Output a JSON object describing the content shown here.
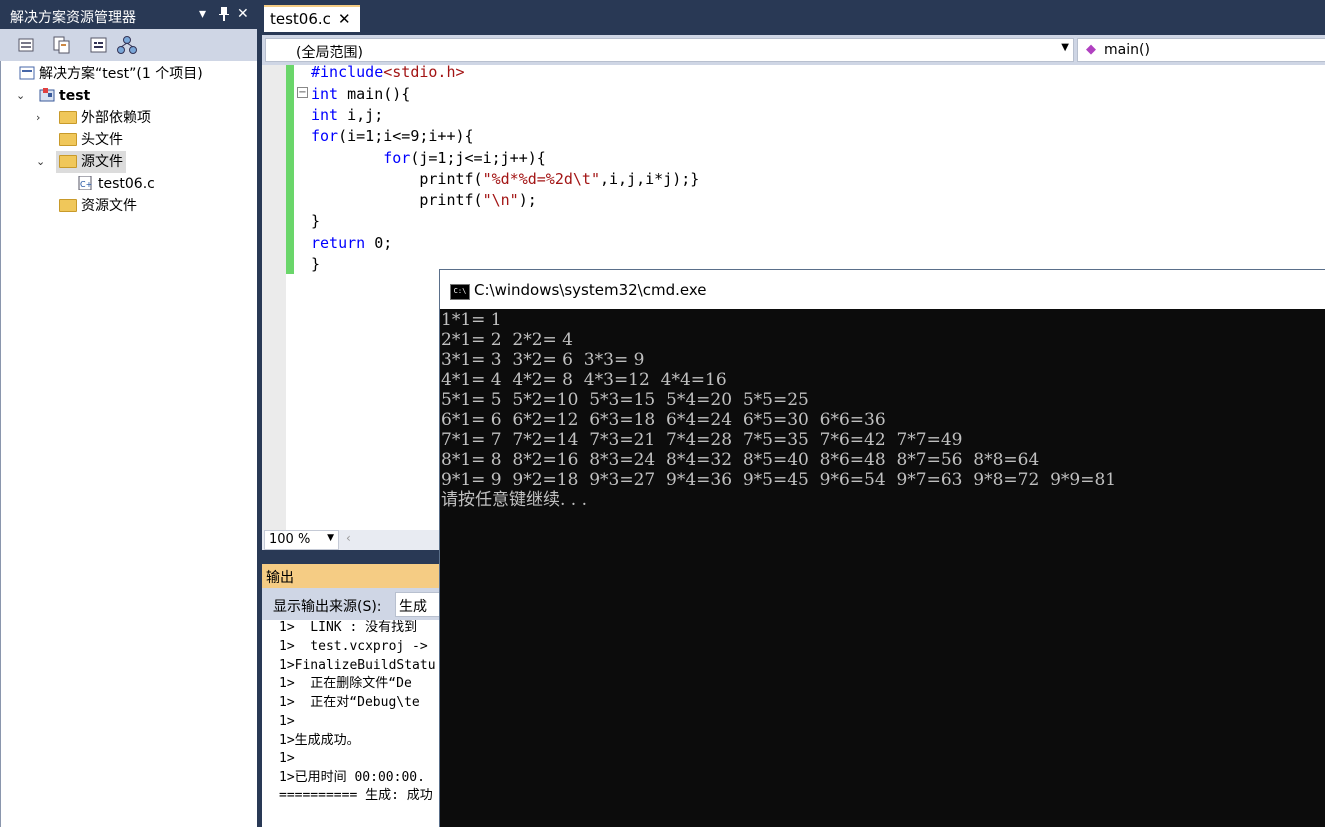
{
  "solution_explorer": {
    "title": "解决方案资源管理器",
    "pin_glyph": "▾",
    "autohide_glyph": "ꟷ",
    "close_glyph": "✕",
    "tree": {
      "solution": "解决方案“test”(1 个项目)",
      "project": "test",
      "external_deps": "外部依赖项",
      "headers": "头文件",
      "sources": "源文件",
      "source_file": "test06.c",
      "resources": "资源文件"
    }
  },
  "editor": {
    "tab_label": "test06.c",
    "tab_close": "✕",
    "scope_combo": "(全局范围)",
    "member_combo": "main()",
    "zoom": "100 %",
    "code": [
      "#include<stdio.h>",
      "int main(){",
      "int i,j;",
      "for(i=1;i<=9;i++){",
      "        for(j=1;j<=i;j++){",
      "            printf(\"%d*%d=%2d\\t\",i,j,i*j);}",
      "            printf(\"\\n\");",
      "}",
      "return 0;",
      "}"
    ]
  },
  "output": {
    "title": "输出",
    "source_label": "显示输出来源(S):",
    "source_value": "生成",
    "lines": [
      "1>  LINK : 没有找到 ",
      "1>  test.vcxproj -> ",
      "1>FinalizeBuildStatu",
      "1>  正在删除文件“De",
      "1>  正在对“Debug\\te",
      "1>",
      "1>生成成功。",
      "1>",
      "1>已用时间 00:00:00.",
      "========== 生成: 成功"
    ]
  },
  "cmd": {
    "title": "C:\\windows\\system32\\cmd.exe",
    "icon_text": "C:\\",
    "lines": [
      "1*1= 1",
      "2*1= 2  2*2= 4",
      "3*1= 3  3*2= 6  3*3= 9",
      "4*1= 4  4*2= 8  4*3=12  4*4=16",
      "5*1= 5  5*2=10  5*3=15  5*4=20  5*5=25",
      "6*1= 6  6*2=12  6*3=18  6*4=24  6*5=30  6*6=36",
      "7*1= 7  7*2=14  7*3=21  7*4=28  7*5=35  7*6=42  7*7=49",
      "8*1= 8  8*2=16  8*3=24  8*4=32  8*5=40  8*6=48  8*7=56  8*8=64",
      "9*1= 9  9*2=18  9*3=27  9*4=36  9*5=45  9*6=54  9*7=63  9*8=72  9*9=81",
      "请按任意键继续. . ."
    ]
  }
}
